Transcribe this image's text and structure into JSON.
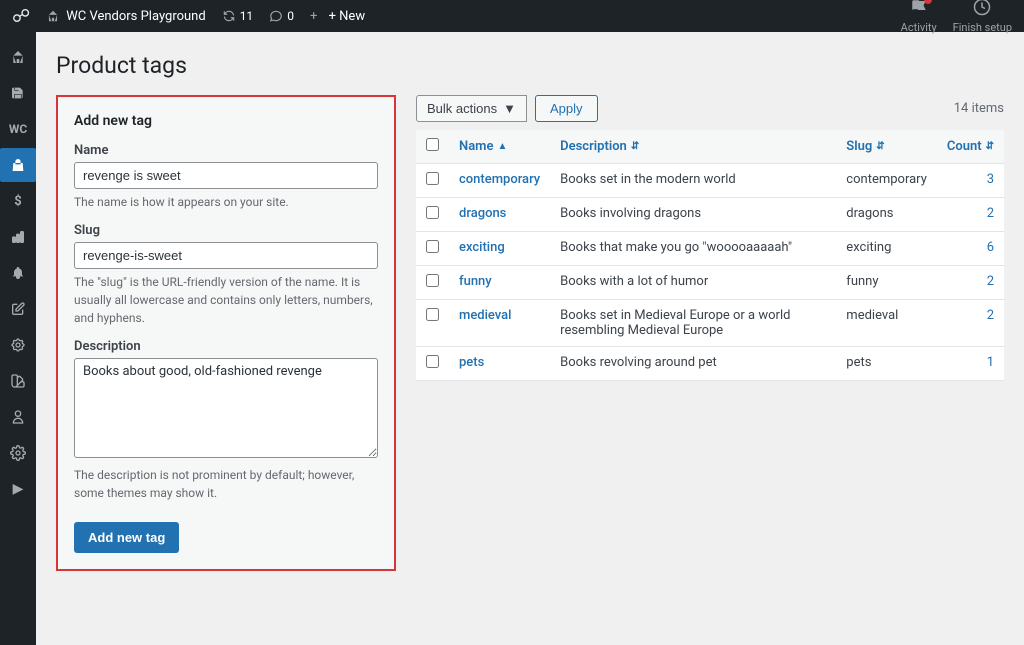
{
  "admin_bar": {
    "logo": "W",
    "site_name": "WC Vendors Playground",
    "updates_icon": "↻",
    "updates_count": "11",
    "comments_icon": "💬",
    "comments_count": "0",
    "new_label": "+ New",
    "activity_label": "Activity",
    "finish_setup_label": "Finish setup"
  },
  "sidebar": {
    "items": [
      {
        "icon": "🏠",
        "name": "dashboard"
      },
      {
        "icon": "📝",
        "name": "posts"
      },
      {
        "icon": "🛒",
        "name": "woocommerce"
      },
      {
        "icon": "📦",
        "name": "products",
        "active": true
      },
      {
        "icon": "$",
        "name": "sales"
      },
      {
        "icon": "📊",
        "name": "analytics"
      },
      {
        "icon": "🔔",
        "name": "notifications"
      },
      {
        "icon": "✏️",
        "name": "editor"
      },
      {
        "icon": "🔧",
        "name": "tools"
      },
      {
        "icon": "✂️",
        "name": "appearance"
      },
      {
        "icon": "👤",
        "name": "users"
      },
      {
        "icon": "🔩",
        "name": "settings"
      },
      {
        "icon": "▶",
        "name": "media"
      }
    ]
  },
  "page": {
    "title": "Product tags"
  },
  "add_tag_form": {
    "heading": "Add new tag",
    "name_label": "Name",
    "name_value": "revenge is sweet",
    "name_hint": "The name is how it appears on your site.",
    "slug_label": "Slug",
    "slug_value": "revenge-is-sweet",
    "slug_hint": "The \"slug\" is the URL-friendly version of the name. It is usually all lowercase and contains only letters, numbers, and hyphens.",
    "description_label": "Description",
    "description_value": "Books about good, old-fashioned revenge",
    "description_hint": "The description is not prominent by default; however, some themes may show it.",
    "submit_label": "Add new tag"
  },
  "toolbar": {
    "bulk_actions_label": "Bulk actions",
    "apply_label": "Apply",
    "items_count": "14 items"
  },
  "table": {
    "columns": [
      {
        "key": "name",
        "label": "Name",
        "sortable": true
      },
      {
        "key": "description",
        "label": "Description",
        "sortable": true
      },
      {
        "key": "slug",
        "label": "Slug",
        "sortable": true
      },
      {
        "key": "count",
        "label": "Count",
        "sortable": true
      }
    ],
    "rows": [
      {
        "id": 1,
        "name": "contemporary",
        "description": "Books set in the modern world",
        "slug": "contemporary",
        "count": "3"
      },
      {
        "id": 2,
        "name": "dragons",
        "description": "Books involving dragons",
        "slug": "dragons",
        "count": "2"
      },
      {
        "id": 3,
        "name": "exciting",
        "description": "Books that make you go \"wooooaaaaah\"",
        "slug": "exciting",
        "count": "6"
      },
      {
        "id": 4,
        "name": "funny",
        "description": "Books with a lot of humor",
        "slug": "funny",
        "count": "2"
      },
      {
        "id": 5,
        "name": "medieval",
        "description": "Books set in Medieval Europe or a world resembling Medieval Europe",
        "slug": "medieval",
        "count": "2"
      },
      {
        "id": 6,
        "name": "pets",
        "description": "Books revolving around pet",
        "slug": "pets",
        "count": "1"
      }
    ]
  }
}
